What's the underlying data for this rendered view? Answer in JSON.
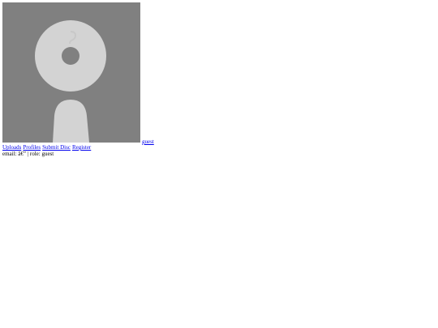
{
  "user": {
    "name": "guest",
    "avatar_icon": "default-avatar-icon"
  },
  "nav": {
    "items": [
      {
        "label": "Uploads"
      },
      {
        "label": "Profiles"
      },
      {
        "label": "Submit Disc"
      },
      {
        "label": "Register"
      }
    ]
  },
  "info": {
    "email_label": "email:",
    "email_value": "â€”",
    "separator": "|",
    "role_label": "role:",
    "role_value": "guest"
  },
  "colors": {
    "avatar_bg": "#808080",
    "avatar_fg": "#d3d3d3",
    "link": "#0000ee"
  }
}
